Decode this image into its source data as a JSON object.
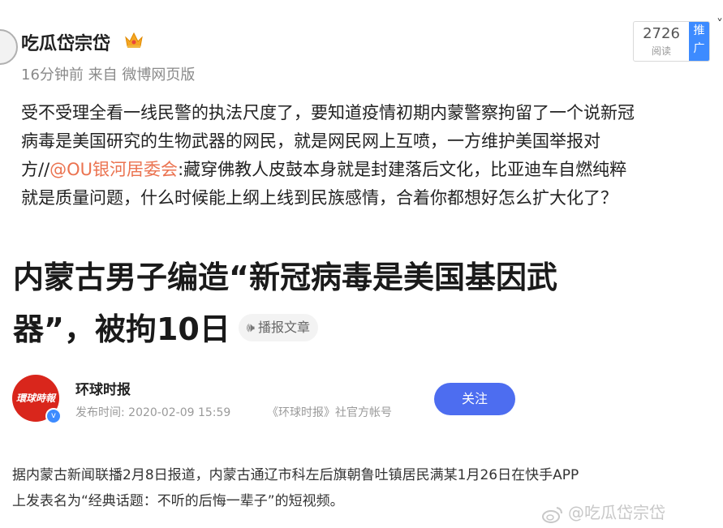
{
  "post": {
    "username": "吃瓜岱宗岱",
    "time": "16分钟前",
    "source": "来自 微博网页版",
    "read_count": "2726",
    "read_label": "阅读",
    "promote_label": "推广",
    "text_lines": [
      [
        "受不受理全看一线民警的执法尺度了，要知道疫情初期内蒙警察拘留了一个说新冠"
      ],
      [
        "病毒是美国研究的生物武器的网民，就是网民网上互喷，一方维护美国举报对"
      ],
      [
        "方//",
        "@OU银河居委会",
        ":藏穿佛教人皮鼓本身就是封建落后文化，比亚迪车自燃纯粹"
      ],
      [
        "就是质量问题，什么时候能上纲上线到民族感情，合着你都想好怎么扩大化了？"
      ]
    ]
  },
  "article": {
    "title_line1": "内蒙古男子编造“新冠病毒是美国基因武",
    "title_line2": "器”，被拘10日",
    "play_label": "播报文章",
    "source_name": "环球时报",
    "logo_text": "環球時報",
    "publish_time": "发布时间: 2020-02-09 15:59",
    "account": "《环球时报》社官方帐号",
    "follow_label": "关注",
    "body_lines": [
      "据内蒙古新闻联播2月8日报道，内蒙古通辽市科左后旗朝鲁吐镇居民满某1月26日在快手APP",
      "上发表名为“经典话题：不听的后悔一辈子”的短视频。"
    ]
  },
  "watermark": "@吃瓜岱宗岱",
  "icons": {
    "crown": "crown-icon",
    "speaker": "speaker-icon",
    "weibo": "weibo-logo-icon",
    "verified": "verified-badge-icon"
  },
  "colors": {
    "mention": "#eb7350",
    "promote": "#3d8bff",
    "follow": "#4d6df0",
    "logo_red": "#d9261c"
  }
}
